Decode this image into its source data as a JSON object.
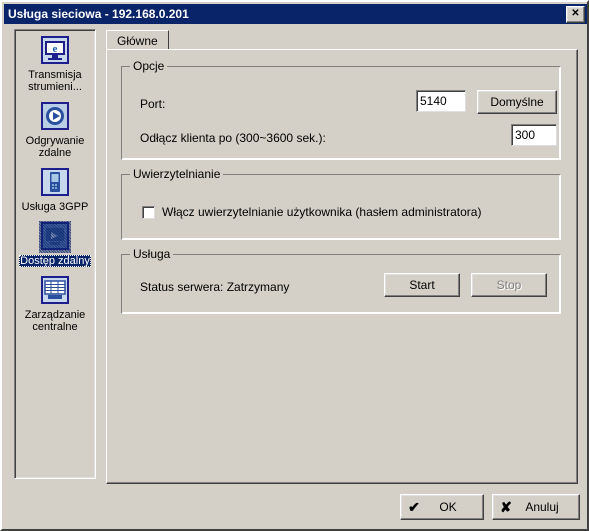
{
  "window": {
    "title": "Usługa sieciowa - 192.168.0.201",
    "close_label": "✕",
    "close_icon": "close-icon",
    "titlebar_color": "#0a246a",
    "face_color": "#d4d0c8"
  },
  "sidebar": {
    "items": [
      {
        "label": "Transmisja strumieni...",
        "icon": "monitor-browser-icon",
        "selected": false
      },
      {
        "label": "Odgrywanie zdalne",
        "icon": "play-circle-icon",
        "selected": false
      },
      {
        "label": "Usługa 3GPP",
        "icon": "mobile-phone-icon",
        "selected": false
      },
      {
        "label": "Dostęp zdalny",
        "icon": "remote-access-icon",
        "selected": true
      },
      {
        "label": "Zarządzanie centralne",
        "icon": "server-rack-icon",
        "selected": false
      }
    ]
  },
  "tabs": [
    {
      "label": "Główne",
      "active": true
    }
  ],
  "options_group": {
    "title": "Opcje",
    "port_label": "Port:",
    "port_value": "5140",
    "default_button": "Domyślne",
    "timeout_label": "Odłącz klienta po (300~3600 sek.):",
    "timeout_value": "300"
  },
  "auth_group": {
    "title": "Uwierzytelnianie",
    "checkbox_label": "Włącz uwierzytelnianie użytkownika (hasłem administratora)",
    "checked": false
  },
  "service_group": {
    "title": "Usługa",
    "status_label": "Status serwera: Zatrzymany",
    "start_button": "Start",
    "stop_button": "Stop",
    "stop_disabled": true
  },
  "footer": {
    "ok_label": "OK",
    "ok_icon": "checkmark-icon",
    "ok_glyph": "✔",
    "cancel_label": "Anuluj",
    "cancel_icon": "cross-icon",
    "cancel_glyph": "✘"
  }
}
